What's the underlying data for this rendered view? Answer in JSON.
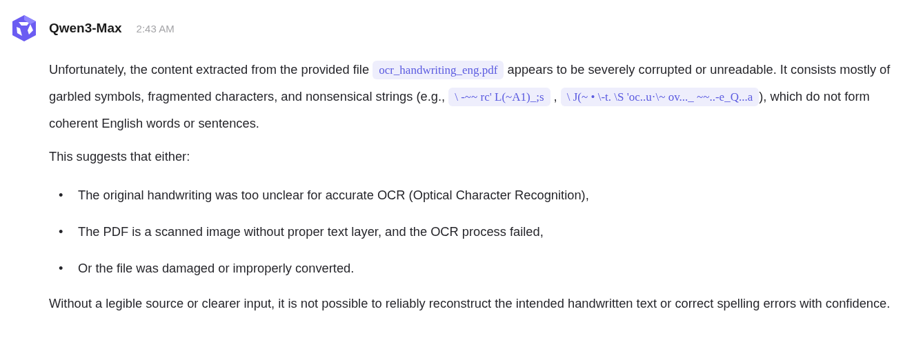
{
  "message": {
    "author": "Qwen3-Max",
    "time": "2:43 AM",
    "blocks": [
      {
        "kind": "paragraph",
        "segments": [
          {
            "kind": "text",
            "text": "Unfortunately, the content extracted from the provided file "
          },
          {
            "kind": "code",
            "text": "ocr_handwriting_eng.pdf"
          },
          {
            "kind": "text",
            "text": " appears to be severely corrupted or unreadable. It consists mostly of garbled symbols, fragmented characters, and nonsensical strings (e.g., "
          },
          {
            "kind": "code",
            "text": "\\ -~~ rc' L(~A1)_;s"
          },
          {
            "kind": "text",
            "text": " , "
          },
          {
            "kind": "code",
            "text": "\\ J(~ • \\-t. \\S 'oc..u·\\~ ov..._ ~~..-e_Q...a"
          },
          {
            "kind": "text",
            "text": "), which do not form coherent English words or sentences."
          }
        ]
      },
      {
        "kind": "paragraph",
        "segments": [
          {
            "kind": "text",
            "text": "This suggests that either:"
          }
        ]
      },
      {
        "kind": "list",
        "items": [
          {
            "bullet": "•",
            "text": "The original handwriting was too unclear for accurate OCR (Optical Character Recognition),"
          },
          {
            "bullet": "•",
            "text": "The PDF is a scanned image without proper text layer, and the OCR process failed,"
          },
          {
            "bullet": "•",
            "text": "Or the file was damaged or improperly converted."
          }
        ]
      },
      {
        "kind": "paragraph",
        "segments": [
          {
            "kind": "text",
            "text": "Without a legible source or clearer input, it is not possible to reliably reconstruct the intended handwritten text or correct spelling errors with confidence."
          }
        ]
      }
    ]
  }
}
